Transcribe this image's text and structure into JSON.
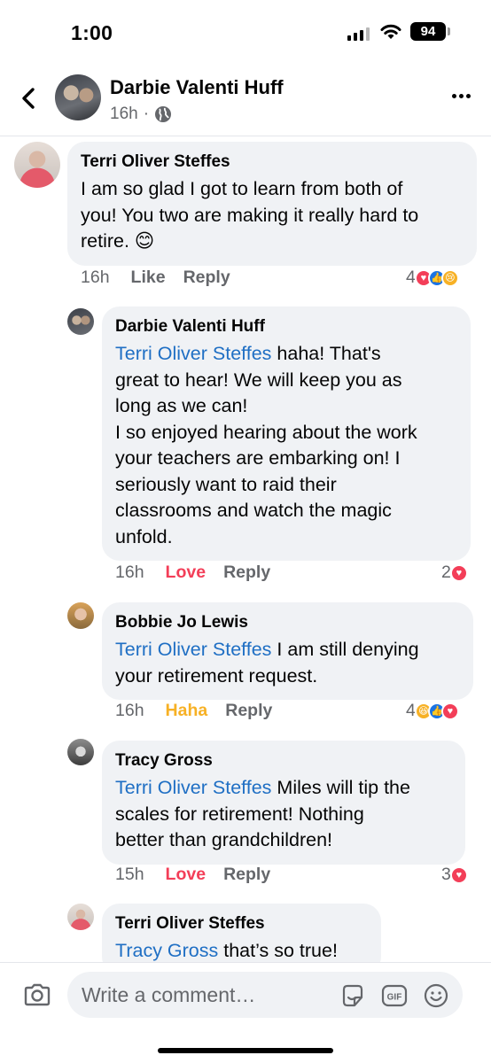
{
  "status_bar": {
    "time": "1:00",
    "battery": "94"
  },
  "header": {
    "name": "Darbie Valenti Huff",
    "time": "16h",
    "separator": "·"
  },
  "comments": [
    {
      "author": "Terri Oliver Steffes",
      "mention": "",
      "text": "I am so glad I got to learn from both of\nyou! You two are making it really hard to\nretire. 😊",
      "time": "16h",
      "reaction_label": "Like",
      "reply_label": "Reply",
      "reaction_count": "4",
      "reaction_types": [
        "love",
        "like",
        "sad"
      ]
    },
    {
      "author": "Darbie Valenti Huff",
      "mention": "Terri Oliver Steffes",
      "text": " haha! That's\ngreat to hear! We will keep you as\nlong as we can!\nI so enjoyed hearing about the work\nyour teachers are embarking on! I\nseriously want to raid their\nclassrooms and watch the magic\nunfold.",
      "time": "16h",
      "reaction_label": "Love",
      "reply_label": "Reply",
      "reaction_count": "2",
      "reaction_types": [
        "love"
      ]
    },
    {
      "author": "Bobbie Jo Lewis",
      "mention": "Terri Oliver Steffes",
      "text": " I am still denying\nyour retirement request.",
      "time": "16h",
      "reaction_label": "Haha",
      "reply_label": "Reply",
      "reaction_count": "4",
      "reaction_types": [
        "haha",
        "like",
        "love"
      ]
    },
    {
      "author": "Tracy Gross",
      "mention": "Terri Oliver Steffes",
      "text": " Miles will tip the\nscales for retirement! Nothing\nbetter than grandchildren!",
      "time": "15h",
      "reaction_label": "Love",
      "reply_label": "Reply",
      "reaction_count": "3",
      "reaction_types": [
        "love"
      ]
    },
    {
      "author": "Terri Oliver Steffes",
      "mention": "Tracy Gross",
      "text": " that’s so true!"
    }
  ],
  "composer": {
    "placeholder": "Write a comment…",
    "gif_label": "GIF"
  },
  "colors": {
    "mention": "#1f6fc4",
    "love": "#f33e58",
    "haha": "#f7b125",
    "like": "#1b74e4",
    "bubble": "#f0f2f5",
    "secondary_text": "#65676b"
  },
  "icons": [
    "back-chevron-icon",
    "globe-icon",
    "more-icon",
    "camera-icon",
    "sticker-icon",
    "gif-icon",
    "emoji-icon",
    "wifi-icon",
    "signal-icon",
    "battery-icon"
  ]
}
